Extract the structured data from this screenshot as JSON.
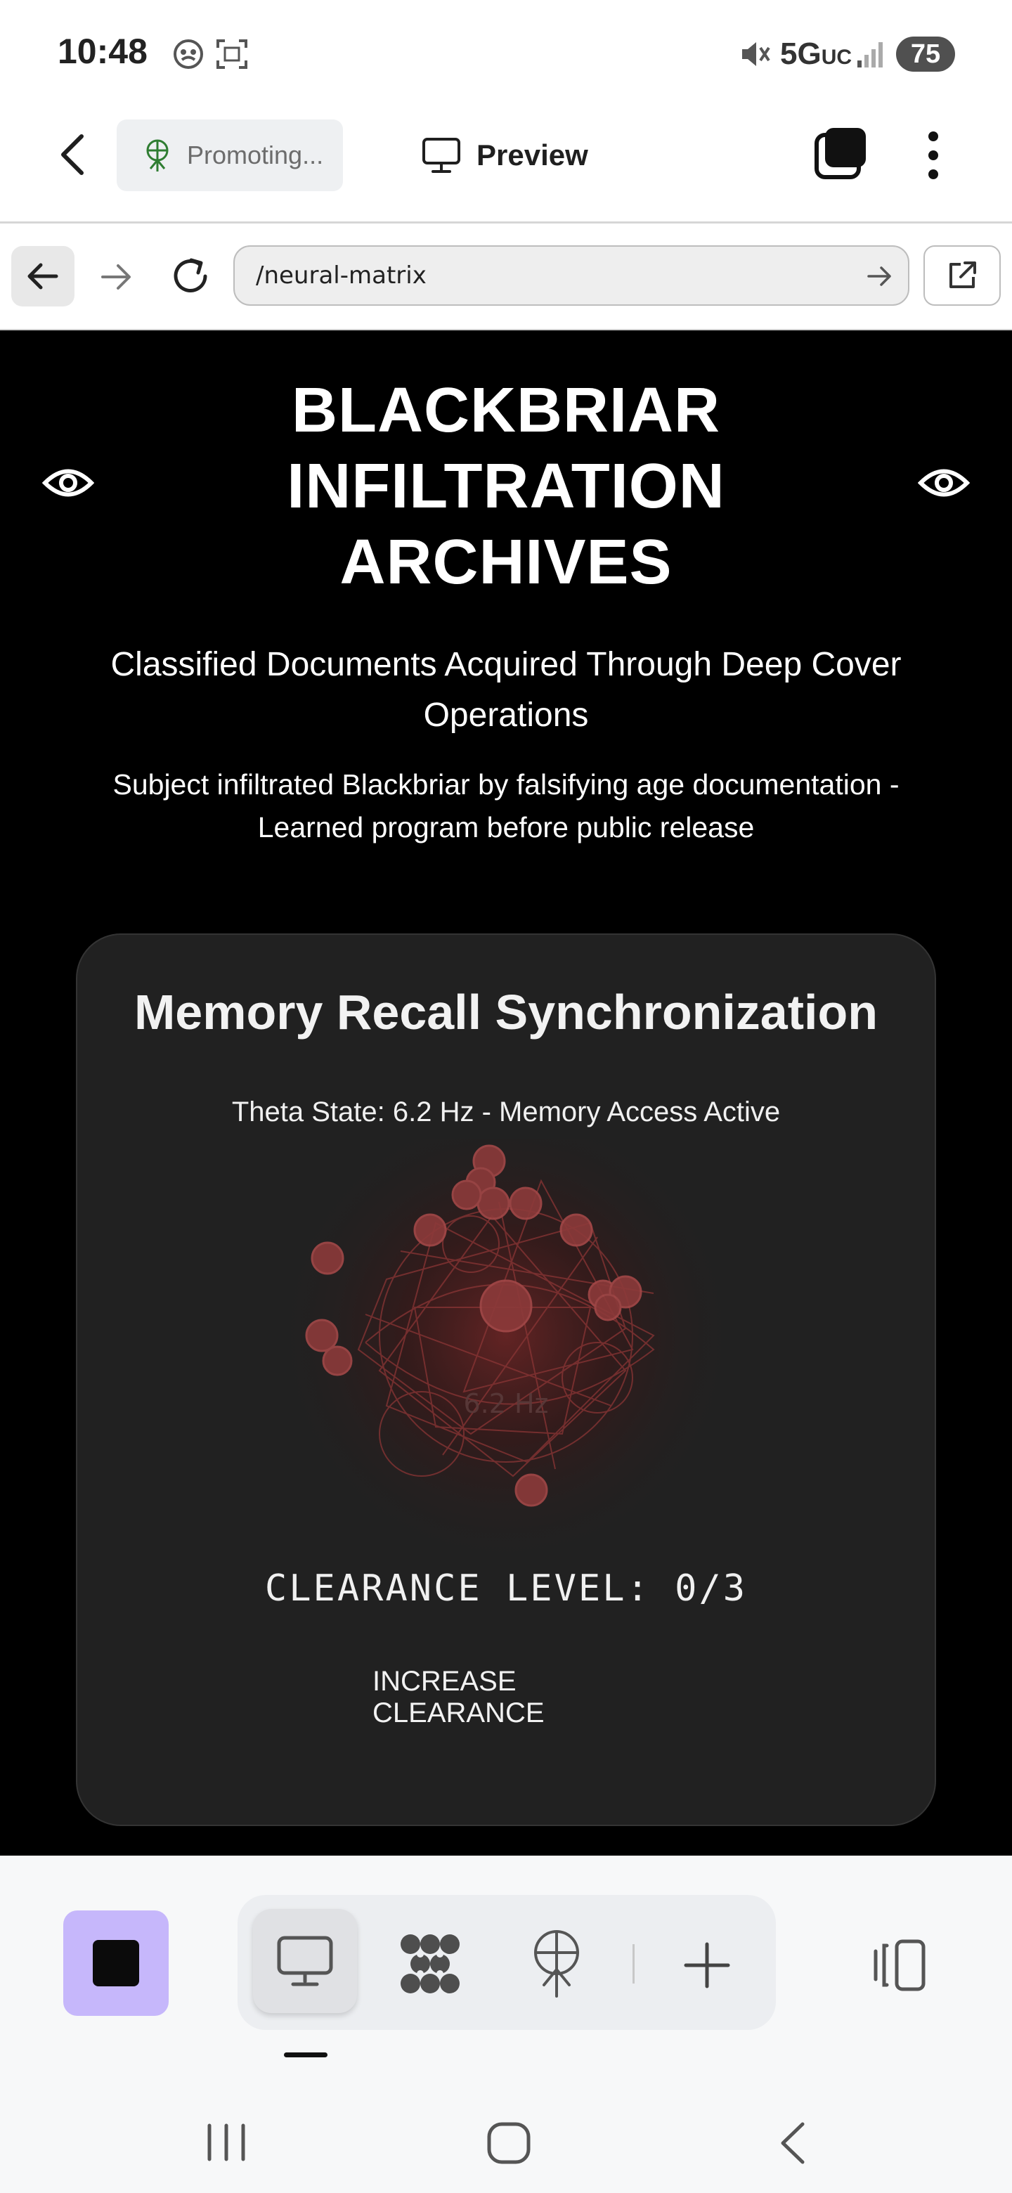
{
  "status_bar": {
    "time": "10:48",
    "network": "5G",
    "network_suffix": "UC",
    "battery": "75"
  },
  "toolbar": {
    "promote_label": "Promoting...",
    "preview_label": "Preview"
  },
  "browser": {
    "url": "/neural-matrix"
  },
  "site": {
    "title": "BLACKBRIAR INFILTRATION ARCHIVES",
    "subtitle": "Classified Documents Acquired Through Deep Cover Operations",
    "note": "Subject infiltrated Blackbriar by falsifying age documentation - Learned program before public release"
  },
  "panel": {
    "title": "Memory Recall Synchronization",
    "state": "Theta State: 6.2 Hz - Memory Access Active",
    "visual_label": "6.2 Hz",
    "clearance": "CLEARANCE LEVEL: 0/3",
    "increase_button": "INCREASE CLEARANCE"
  },
  "colors": {
    "accent_purple": "#c6b7fb",
    "page_background": "#000000",
    "panel_background": "#212121",
    "visual_red": "#7a2b2b"
  },
  "icons": [
    "back-arrow-icon",
    "antenna-icon",
    "monitor-icon",
    "tabs-icon",
    "more-vert-icon",
    "browser-back-icon",
    "browser-forward-icon",
    "reload-icon",
    "go-arrow-icon",
    "open-external-icon",
    "eye-icon",
    "stop-icon",
    "pattern-icon",
    "plus-icon",
    "side-panel-icon"
  ]
}
